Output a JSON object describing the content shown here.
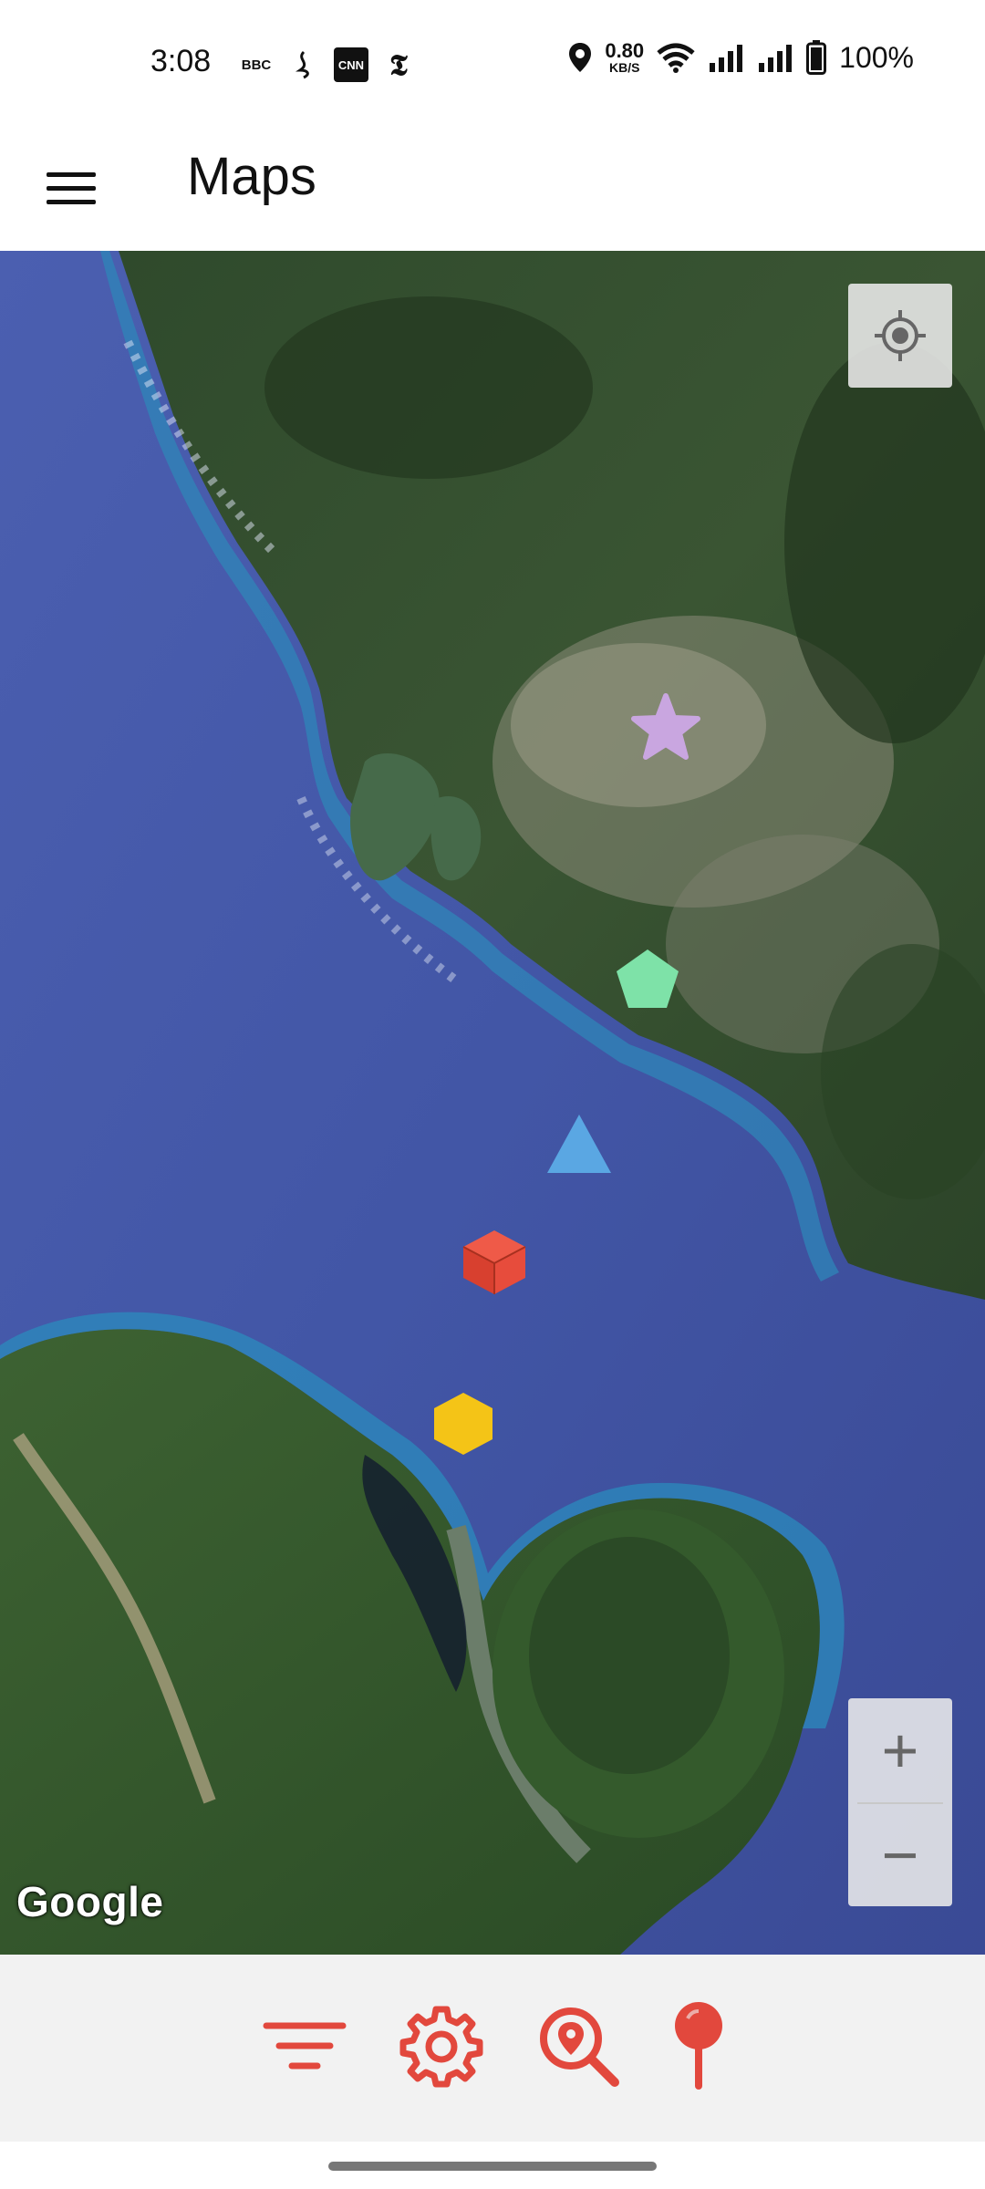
{
  "status_bar": {
    "time": "3:08",
    "notification_icons": [
      "bbc-news-icon",
      "al-jazeera-icon",
      "cnn-icon",
      "nyt-icon"
    ],
    "cnn_label": "CNN",
    "bbc_label": "BBC",
    "net_speed_value": "0.80",
    "net_speed_unit": "KB/S",
    "battery_percent": "100%"
  },
  "app_bar": {
    "title": "Maps",
    "menu_icon": "hamburger-menu-icon"
  },
  "map": {
    "attribution": "Google",
    "controls": {
      "locate_icon": "my-location-icon",
      "zoom_in_label": "+",
      "zoom_out_label": "−"
    },
    "markers": [
      {
        "shape": "star",
        "color": "#c9a6e0"
      },
      {
        "shape": "pentagon",
        "color": "#7ee2a8"
      },
      {
        "shape": "triangle",
        "color": "#5aa7e3"
      },
      {
        "shape": "cube",
        "color": "#e74c3c"
      },
      {
        "shape": "hexagon",
        "color": "#f4c417"
      }
    ]
  },
  "bottom_toolbar": {
    "accent_color": "#e2483d",
    "tools": [
      "filter-icon",
      "settings-gear-icon",
      "search-location-icon",
      "place-pin-icon"
    ]
  }
}
